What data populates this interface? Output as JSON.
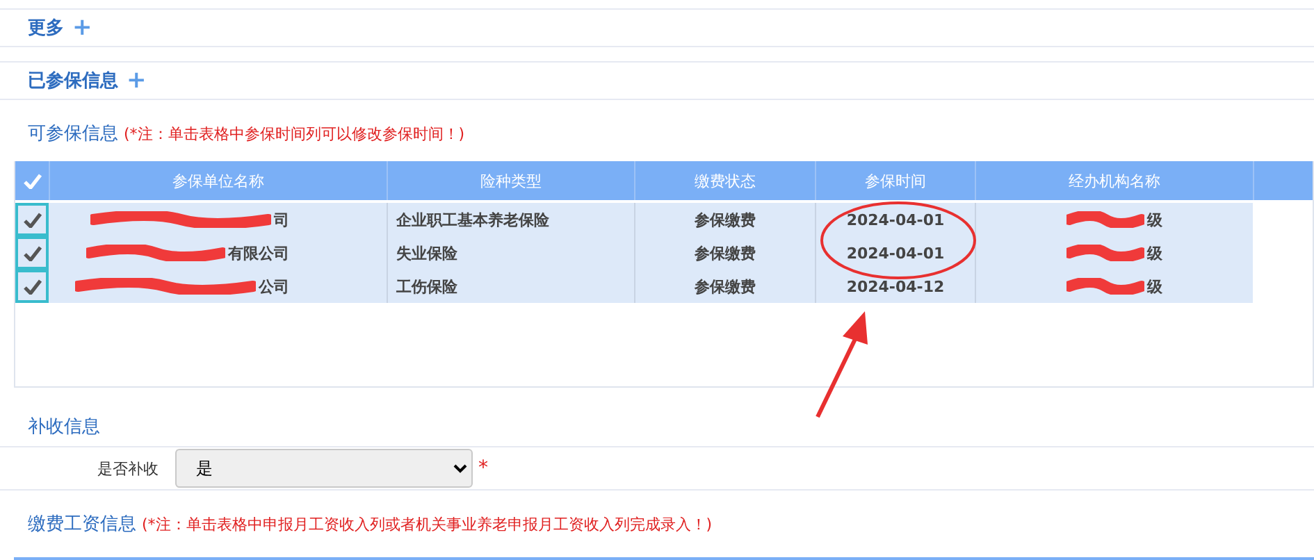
{
  "collapsed_sections": [
    {
      "title": "更多",
      "toggle": "+"
    },
    {
      "title": "已参保信息",
      "toggle": "+"
    }
  ],
  "insurable_section": {
    "title": "可参保信息",
    "note": "(*注：单击表格中参保时间列可以修改参保时间！)"
  },
  "table": {
    "all_checked": true,
    "columns": [
      "参保单位名称",
      "险种类型",
      "缴费状态",
      "参保时间",
      "经办机构名称"
    ],
    "rows": [
      {
        "checked": true,
        "unit": "司",
        "type": "企业职工基本养老保险",
        "status": "参保缴费",
        "date": "2024-04-01",
        "agency": "级"
      },
      {
        "checked": true,
        "unit": "有限公司",
        "type": "失业保险",
        "status": "参保缴费",
        "date": "2024-04-01",
        "agency": "级"
      },
      {
        "checked": true,
        "unit": "公司",
        "type": "工伤保险",
        "status": "参保缴费",
        "date": "2024-04-12",
        "agency": "级"
      }
    ]
  },
  "back_pay_section": {
    "title": "补收信息",
    "field_label": "是否补收",
    "value": "是",
    "required_mark": "*"
  },
  "wage_section": {
    "title": "缴费工资信息",
    "note": "(*注：单击表格中申报月工资收入列或者机关事业养老申报月工资收入列完成录入！)"
  }
}
